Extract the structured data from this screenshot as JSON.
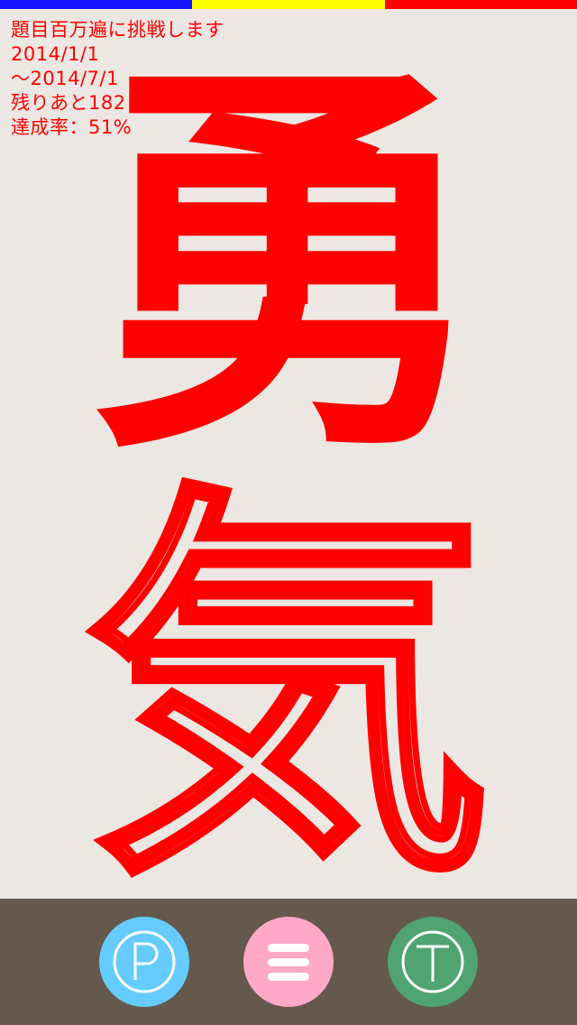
{
  "top_bar": {
    "colors": [
      "#1414FF",
      "#FFFF00",
      "#FF0000"
    ]
  },
  "info": {
    "line1": "題目百万遍に挑戦します",
    "line2": "2014/1/1",
    "line3": "～2014/7/1",
    "line4": "残りあと182日",
    "line5": "達成率：51%"
  },
  "progress": {
    "percent": 51
  },
  "kanji": {
    "first": "勇",
    "second": "気"
  },
  "colors": {
    "text_red": "#FF0000",
    "background": "#ECE7E2",
    "bottom_bar": "#65594D",
    "p_button": "#66CCFF",
    "menu_button": "#FFA8C8",
    "t_button": "#4FA471"
  },
  "bottom_bar": {
    "buttons": [
      {
        "icon": "circled-p-icon"
      },
      {
        "icon": "hamburger-menu-icon"
      },
      {
        "icon": "circled-t-icon"
      }
    ]
  }
}
